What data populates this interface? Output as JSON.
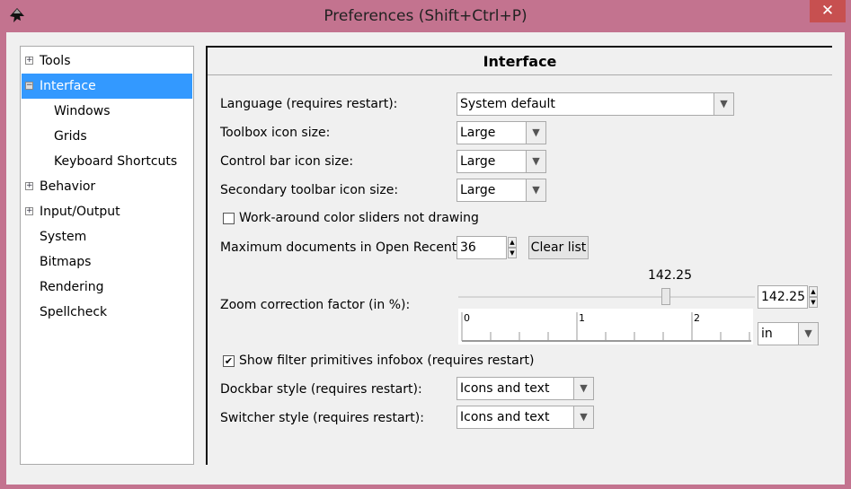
{
  "window": {
    "title": "Preferences (Shift+Ctrl+P)",
    "close_icon": "close-icon",
    "accent": "#3399ff",
    "titlebar_color": "#c3738f"
  },
  "tree": [
    {
      "label": "Tools",
      "expander": "+",
      "level": 0
    },
    {
      "label": "Interface",
      "expander": "−",
      "level": 0,
      "selected": true
    },
    {
      "label": "Windows",
      "level": 1
    },
    {
      "label": "Grids",
      "level": 1
    },
    {
      "label": "Keyboard Shortcuts",
      "level": 1
    },
    {
      "label": "Behavior",
      "expander": "+",
      "level": 0
    },
    {
      "label": "Input/Output",
      "expander": "+",
      "level": 0
    },
    {
      "label": "System",
      "level": 0
    },
    {
      "label": "Bitmaps",
      "level": 0
    },
    {
      "label": "Rendering",
      "level": 0
    },
    {
      "label": "Spellcheck",
      "level": 0
    }
  ],
  "panel": {
    "title": "Interface",
    "language": {
      "label": "Language (requires restart):",
      "value": "System default"
    },
    "toolbox": {
      "label": "Toolbox icon size:",
      "value": "Large"
    },
    "controlbar": {
      "label": "Control bar icon size:",
      "value": "Large"
    },
    "secondary": {
      "label": "Secondary toolbar icon size:",
      "value": "Large"
    },
    "workaround": {
      "label": "Work-around color sliders not drawing",
      "checked": false
    },
    "maxdocs": {
      "label": "Maximum documents in Open Recent:",
      "value": "36",
      "clear": "Clear list"
    },
    "zoom": {
      "label": "Zoom correction factor (in %):",
      "slider_value": "142.25",
      "value": "142.25",
      "unit": "in",
      "ruler_labels": [
        "0",
        "1",
        "2"
      ]
    },
    "filter": {
      "label": "Show filter primitives infobox (requires restart)",
      "checked": true,
      "mark": "✔"
    },
    "dockbar": {
      "label": "Dockbar style (requires restart):",
      "value": "Icons and text"
    },
    "switcher": {
      "label": "Switcher style (requires restart):",
      "value": "Icons and text"
    }
  }
}
